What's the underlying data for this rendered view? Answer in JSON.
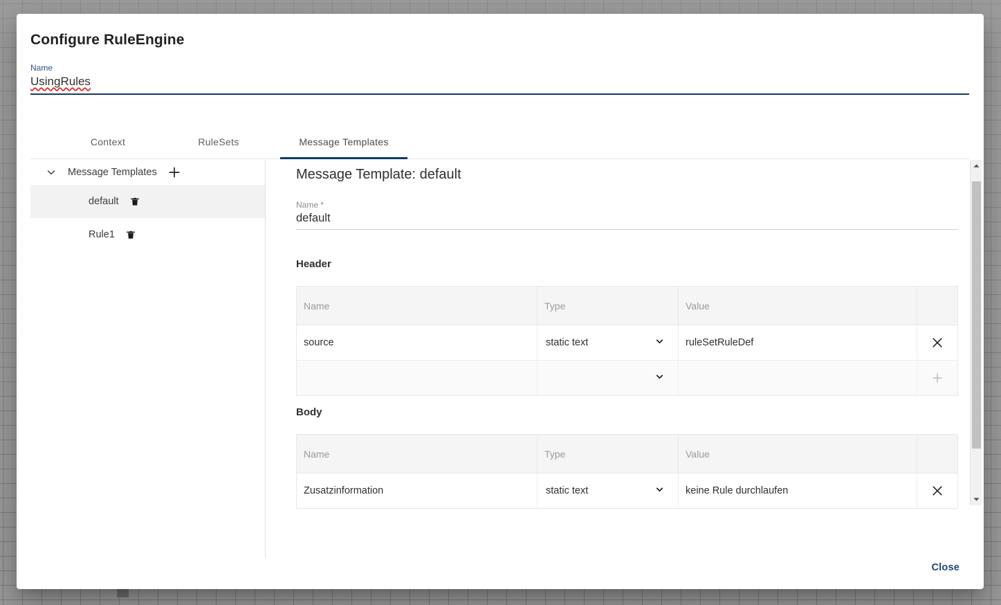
{
  "dialog": {
    "title": "Configure RuleEngine",
    "close_label": "Close"
  },
  "name_field": {
    "label": "Name",
    "value": "UsingRules"
  },
  "tabs": [
    {
      "label": "Context",
      "active": false
    },
    {
      "label": "RuleSets",
      "active": false
    },
    {
      "label": "Message Templates",
      "active": true
    }
  ],
  "sidebar": {
    "root_label": "Message Templates",
    "chevron_icon": "chevron-down-icon",
    "add_icon": "plus-icon",
    "items": [
      {
        "label": "default",
        "selected": true,
        "delete_icon": "trash-icon"
      },
      {
        "label": "Rule1",
        "selected": false,
        "delete_icon": "trash-icon"
      }
    ]
  },
  "main": {
    "panel_title": "Message Template: default",
    "template_name": {
      "label": "Name *",
      "value": "default"
    },
    "sections": {
      "header": {
        "title": "Header",
        "columns": [
          "Name",
          "Type",
          "Value",
          ""
        ],
        "rows": [
          {
            "name": "source",
            "type": "static text",
            "value": "ruleSetRuleDef",
            "action_icon": "close-icon",
            "empty": false
          },
          {
            "name": "",
            "type": "",
            "value": "",
            "action_icon": "plus-icon",
            "empty": true
          }
        ]
      },
      "body": {
        "title": "Body",
        "columns": [
          "Name",
          "Type",
          "Value",
          ""
        ],
        "rows": [
          {
            "name": "Zusatzinformation",
            "type": "static text",
            "value": "keine Rule durchlaufen",
            "action_icon": "close-icon",
            "empty": false
          }
        ]
      }
    },
    "type_options": [
      "static text"
    ]
  },
  "scrollbar": {
    "up_icon": "caret-up-icon",
    "down_icon": "caret-down-icon"
  },
  "colors": {
    "accent": "#0d3b66",
    "link": "#1c4478",
    "header_row_bg": "#f5f5f5",
    "selected_item_bg": "#f2f2f2",
    "spellcheck_underline": "#dd2222"
  }
}
